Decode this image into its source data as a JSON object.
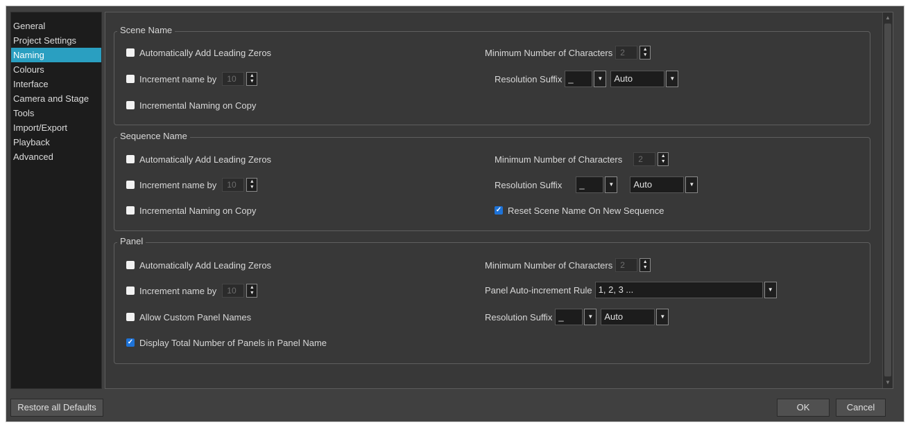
{
  "sidebar": {
    "items": [
      {
        "label": "General"
      },
      {
        "label": "Project Settings"
      },
      {
        "label": "Naming",
        "active": true
      },
      {
        "label": "Colours"
      },
      {
        "label": "Interface"
      },
      {
        "label": "Camera and Stage"
      },
      {
        "label": "Tools"
      },
      {
        "label": "Import/Export"
      },
      {
        "label": "Playback"
      },
      {
        "label": "Advanced"
      }
    ]
  },
  "scene": {
    "title": "Scene Name",
    "leading_zeros": {
      "label": "Automatically Add Leading Zeros",
      "checked": false
    },
    "increment": {
      "label": "Increment name by",
      "value": "10",
      "checked": false
    },
    "copy": {
      "label": "Incremental Naming on Copy",
      "checked": false
    },
    "min_chars": {
      "label": "Minimum Number of Characters",
      "value": "2"
    },
    "res_suffix": {
      "label": "Resolution Suffix",
      "separator": "_",
      "mode": "Auto"
    }
  },
  "sequence": {
    "title": "Sequence Name",
    "leading_zeros": {
      "label": "Automatically Add Leading Zeros",
      "checked": false
    },
    "increment": {
      "label": "Increment name by",
      "value": "10",
      "checked": false
    },
    "copy": {
      "label": "Incremental Naming on Copy",
      "checked": false
    },
    "min_chars": {
      "label": "Minimum Number of Characters",
      "value": "2"
    },
    "res_suffix": {
      "label": "Resolution Suffix",
      "separator": "_",
      "mode": "Auto"
    },
    "reset": {
      "label": "Reset Scene Name On New Sequence",
      "checked": true
    }
  },
  "panel": {
    "title": "Panel",
    "leading_zeros": {
      "label": "Automatically Add Leading Zeros",
      "checked": false
    },
    "increment": {
      "label": "Increment name by",
      "value": "10",
      "checked": false
    },
    "custom": {
      "label": "Allow Custom Panel Names",
      "checked": false
    },
    "display_total": {
      "label": "Display Total Number of Panels in Panel Name",
      "checked": true
    },
    "min_chars": {
      "label": "Minimum Number of Characters",
      "value": "2"
    },
    "rule": {
      "label": "Panel Auto-increment Rule",
      "value": "1, 2, 3 ..."
    },
    "res_suffix": {
      "label": "Resolution Suffix",
      "separator": "_",
      "mode": "Auto"
    }
  },
  "footer": {
    "restore": "Restore all Defaults",
    "ok": "OK",
    "cancel": "Cancel"
  },
  "icons": {
    "checkmark": "checkmark-icon",
    "spin_up": "arrow-up-icon",
    "spin_down": "arrow-down-icon",
    "dropdown": "chevron-down-icon"
  },
  "colors": {
    "accent": "#2a9fc1",
    "checkbox_checked": "#1e73d8",
    "dialog_bg": "#404040"
  }
}
